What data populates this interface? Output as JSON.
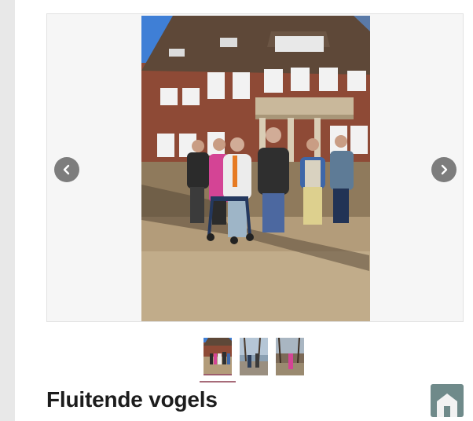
{
  "article": {
    "title": "Fluitende vogels"
  },
  "carousel": {
    "prev_icon": "chevron-left-icon",
    "next_icon": "chevron-right-icon",
    "active_index": 0,
    "slides": [
      {
        "icon": "photo-group-in-front-of-building"
      },
      {
        "icon": "photo-people-walking-in-park"
      },
      {
        "icon": "photo-person-in-pink-in-woods"
      }
    ]
  },
  "home_button": {
    "icon": "home-icon"
  },
  "colors": {
    "nav_button": "#7d7d7d",
    "active_thumb_indicator": "#a76b79",
    "home_button": "#6f8a8a",
    "title": "#1c1c1c"
  }
}
